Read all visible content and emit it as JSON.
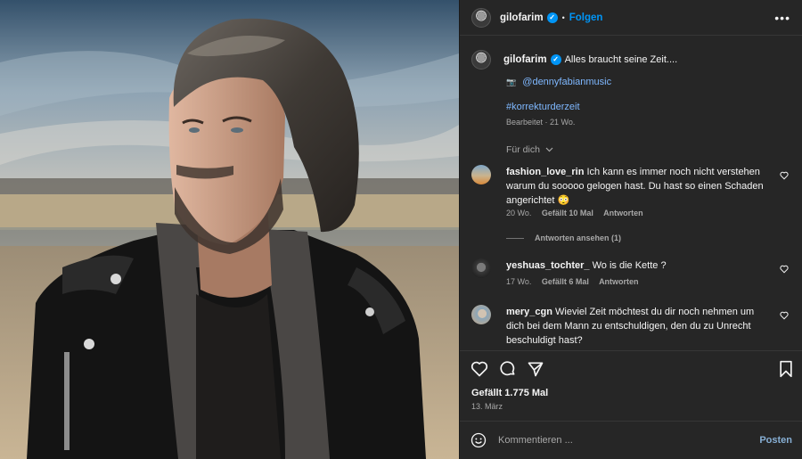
{
  "post": {
    "author": "gilofarim",
    "follow_label": "Folgen",
    "more_label": "•••",
    "verified_mark": "✓"
  },
  "caption": {
    "username": "gilofarim",
    "text": "Alles braucht seine Zeit....",
    "camera_emoji": "📷",
    "mention": "@dennyfabianmusic",
    "hashtag": "#korrekturderzeit",
    "meta": "Bearbeitet · 21 Wo."
  },
  "comments_filter": "Für dich",
  "comments": [
    {
      "username": "fashion_love_rin",
      "text": "Ich kann es immer noch nicht verstehen warum du sooooo gelogen hast. Du hast so einen Schaden angerichtet 😳",
      "time": "20 Wo.",
      "likes": "Gefällt 10 Mal",
      "reply": "Antworten"
    },
    {
      "username": "yeshuas_tochter_",
      "text": "Wo is die Kette ?",
      "time": "17 Wo.",
      "likes": "Gefällt 6 Mal",
      "reply": "Antworten"
    },
    {
      "username": "mery_cgn",
      "text": "Wieviel Zeit möchtest du dir noch nehmen um dich bei dem Mann zu entschuldigen, den du zu Unrecht beschuldigt hast?",
      "time": "",
      "likes": "",
      "reply": ""
    }
  ],
  "view_replies": "Antworten ansehen (1)",
  "likes_count": "Gefällt 1.775 Mal",
  "post_date": "13. März",
  "composer": {
    "placeholder": "Kommentieren ...",
    "post_label": "Posten"
  },
  "colors": {
    "panel_bg": "#262626",
    "accent_blue": "#0095f6",
    "muted": "#a8a8a8"
  }
}
